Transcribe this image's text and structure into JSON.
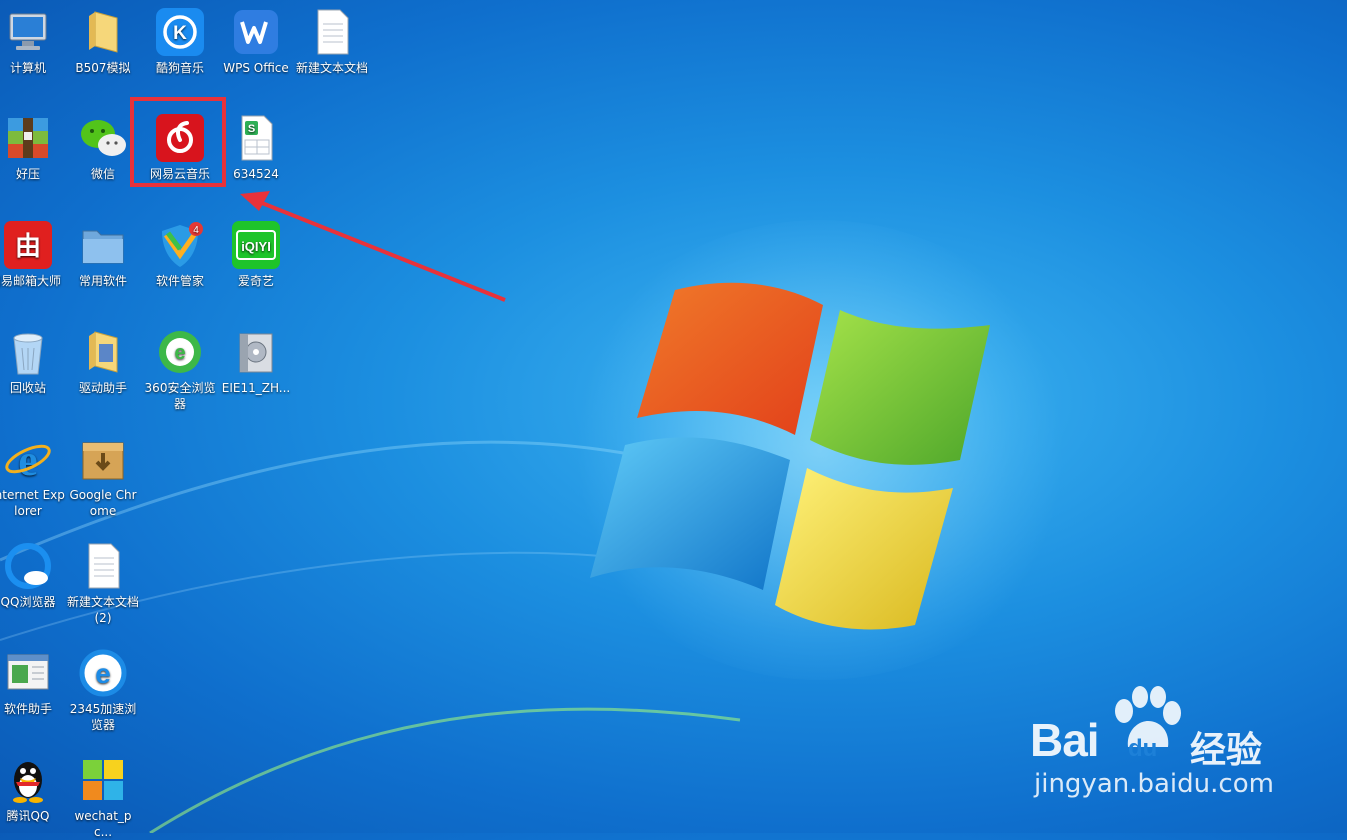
{
  "desktop": {
    "icons": [
      {
        "id": "computer",
        "label": "计算机",
        "icon": "computer-icon"
      },
      {
        "id": "b507",
        "label": "B507模拟",
        "icon": "folder-icon"
      },
      {
        "id": "kugou",
        "label": "酷狗音乐",
        "icon": "kugou-icon"
      },
      {
        "id": "wps",
        "label": "WPS Office",
        "icon": "wps-icon"
      },
      {
        "id": "newtxt1",
        "label": "新建文本文档",
        "icon": "text-file-icon"
      },
      {
        "id": "haozip",
        "label": "好压",
        "icon": "archive-icon"
      },
      {
        "id": "wechat",
        "label": "微信",
        "icon": "wechat-icon"
      },
      {
        "id": "netease",
        "label": "网易云音乐",
        "icon": "netease-music-icon"
      },
      {
        "id": "sheet",
        "label": "634524",
        "icon": "spreadsheet-icon"
      },
      {
        "id": "mailmaster",
        "label": "网易邮箱大师",
        "icon": "mail-master-icon"
      },
      {
        "id": "common",
        "label": "常用软件",
        "icon": "folder-icon"
      },
      {
        "id": "softmgr",
        "label": "软件管家",
        "icon": "shield-icon",
        "badge": "4"
      },
      {
        "id": "iqiyi",
        "label": "爱奇艺",
        "icon": "iqiyi-icon"
      },
      {
        "id": "recycle",
        "label": "回收站",
        "icon": "recycle-bin-icon"
      },
      {
        "id": "driver",
        "label": "驱动助手",
        "icon": "folder-icon"
      },
      {
        "id": "b360",
        "label": "360安全浏览器",
        "icon": "browser-360-icon"
      },
      {
        "id": "eie11",
        "label": "EIE11_ZH...",
        "icon": "installer-icon"
      },
      {
        "id": "ie",
        "label": "Internet Explorer",
        "icon": "ie-icon"
      },
      {
        "id": "chrome",
        "label": "Google Chrome",
        "icon": "package-icon"
      },
      {
        "id": "qqbrowser",
        "label": "QQ浏览器",
        "icon": "qq-browser-icon"
      },
      {
        "id": "newtxt2",
        "label": "新建文本文档 (2)",
        "icon": "text-file-icon"
      },
      {
        "id": "softhelper",
        "label": "软件助手",
        "icon": "window-icon"
      },
      {
        "id": "b2345",
        "label": "2345加速浏览器",
        "icon": "ie-icon"
      },
      {
        "id": "qq",
        "label": "腾讯QQ",
        "icon": "qq-penguin-icon"
      },
      {
        "id": "wechatpc",
        "label": "wechat_pc...",
        "icon": "tiles-icon"
      }
    ]
  },
  "watermark": {
    "brand_left": "Bai",
    "brand_right": "du",
    "brand_cn": "经验",
    "url": "jingyan.baidu.com"
  },
  "colors": {
    "highlight": "#e8323a",
    "arrow": "#e8323a"
  }
}
